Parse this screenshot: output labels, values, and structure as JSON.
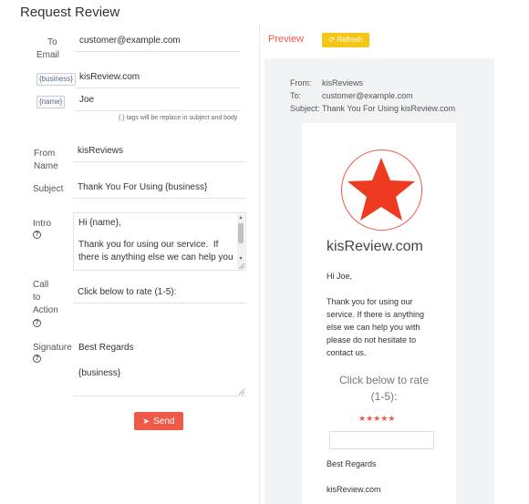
{
  "page": {
    "title": "Request Review"
  },
  "form": {
    "to_label": "To Email",
    "to_line1": "To",
    "to_line2": "Email",
    "to_value": "customer@example.com",
    "business_tag": "{business}",
    "business_value": "kisReview.com",
    "name_tag": "{name}",
    "name_value": "Joe",
    "tags_hint": "{ } tags will be replace in subject and body",
    "from_line1": "From",
    "from_line2": "Name",
    "from_value": "kisReviews",
    "subject_label": "Subject",
    "subject_value": "Thank You For Using {business}",
    "intro_label": "Intro",
    "intro_line1": "Hi {name},",
    "intro_line2": "Thank you for using our service.  If",
    "intro_line3": "there is anything else we can help you",
    "cta_line1": "Call",
    "cta_line2": "to",
    "cta_line3": "Action",
    "cta_value": "Click below to rate (1-5):",
    "signature_label": "Signature",
    "signature_line1": "Best Regards",
    "signature_line2": "{business}",
    "help_icon": "question-circle-icon",
    "send_label": "Send",
    "send_icon": "paper-plane-icon"
  },
  "preview": {
    "title": "Preview",
    "refresh_label": "Refresh",
    "refresh_icon": "refresh-icon",
    "from_label": "From:",
    "from_value": "kisReviews",
    "to_label": "To:",
    "to_value": "customer@example.com",
    "subject_label": "Subject:",
    "subject_value": "Thank You For Using kisReview.com",
    "logo_icon": "star-icon",
    "brand": "kisReview.com",
    "greeting": "Hi Joe,",
    "body_line1": "Thank you for using our",
    "body_line2": "service. If there is anything",
    "body_line3": "else we can help you with",
    "body_line4": "please do not hesitate to",
    "body_line5": "contact us.",
    "cta_line1": "Click below to rate",
    "cta_line2": "(1-5):",
    "stars": "★★★★★",
    "signature": "Best Regards",
    "signature_business": "kisReview.com"
  },
  "colors": {
    "accent": "#ee5a47",
    "refresh": "#f5c518"
  }
}
